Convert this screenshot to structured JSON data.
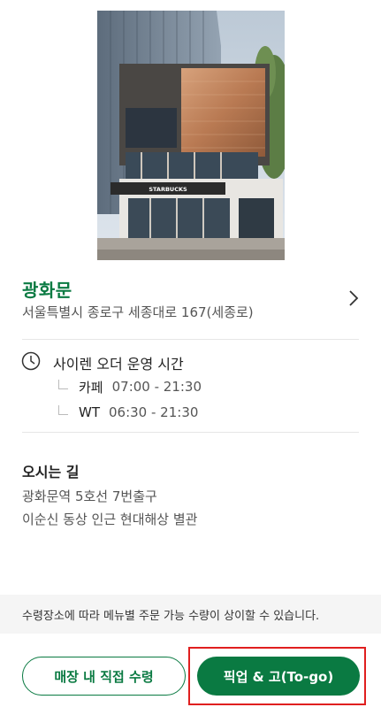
{
  "store": {
    "name": "광화문",
    "address": "서울특별시 종로구 세종대로 167(세종로)",
    "photo_alt": "STARBUCKS"
  },
  "hours": {
    "title": "사이렌 오더 운영 시간",
    "rows": [
      {
        "type": "카페",
        "time": "07:00 - 21:30"
      },
      {
        "type": "WT",
        "time": "06:30 - 21:30"
      }
    ]
  },
  "directions": {
    "title": "오시는 길",
    "lines": [
      "광화문역 5호선 7번출구",
      "이순신 동상 인근 현대해상 별관"
    ]
  },
  "notice": "수령장소에 따라 메뉴별 주문 가능 수량이 상이할 수 있습니다.",
  "buttons": {
    "in_store": "매장 내 직접 수령",
    "to_go": "픽업 & 고(To-go)"
  },
  "colors": {
    "brand_green": "#0a7a42",
    "highlight_red": "#e01f1f"
  }
}
